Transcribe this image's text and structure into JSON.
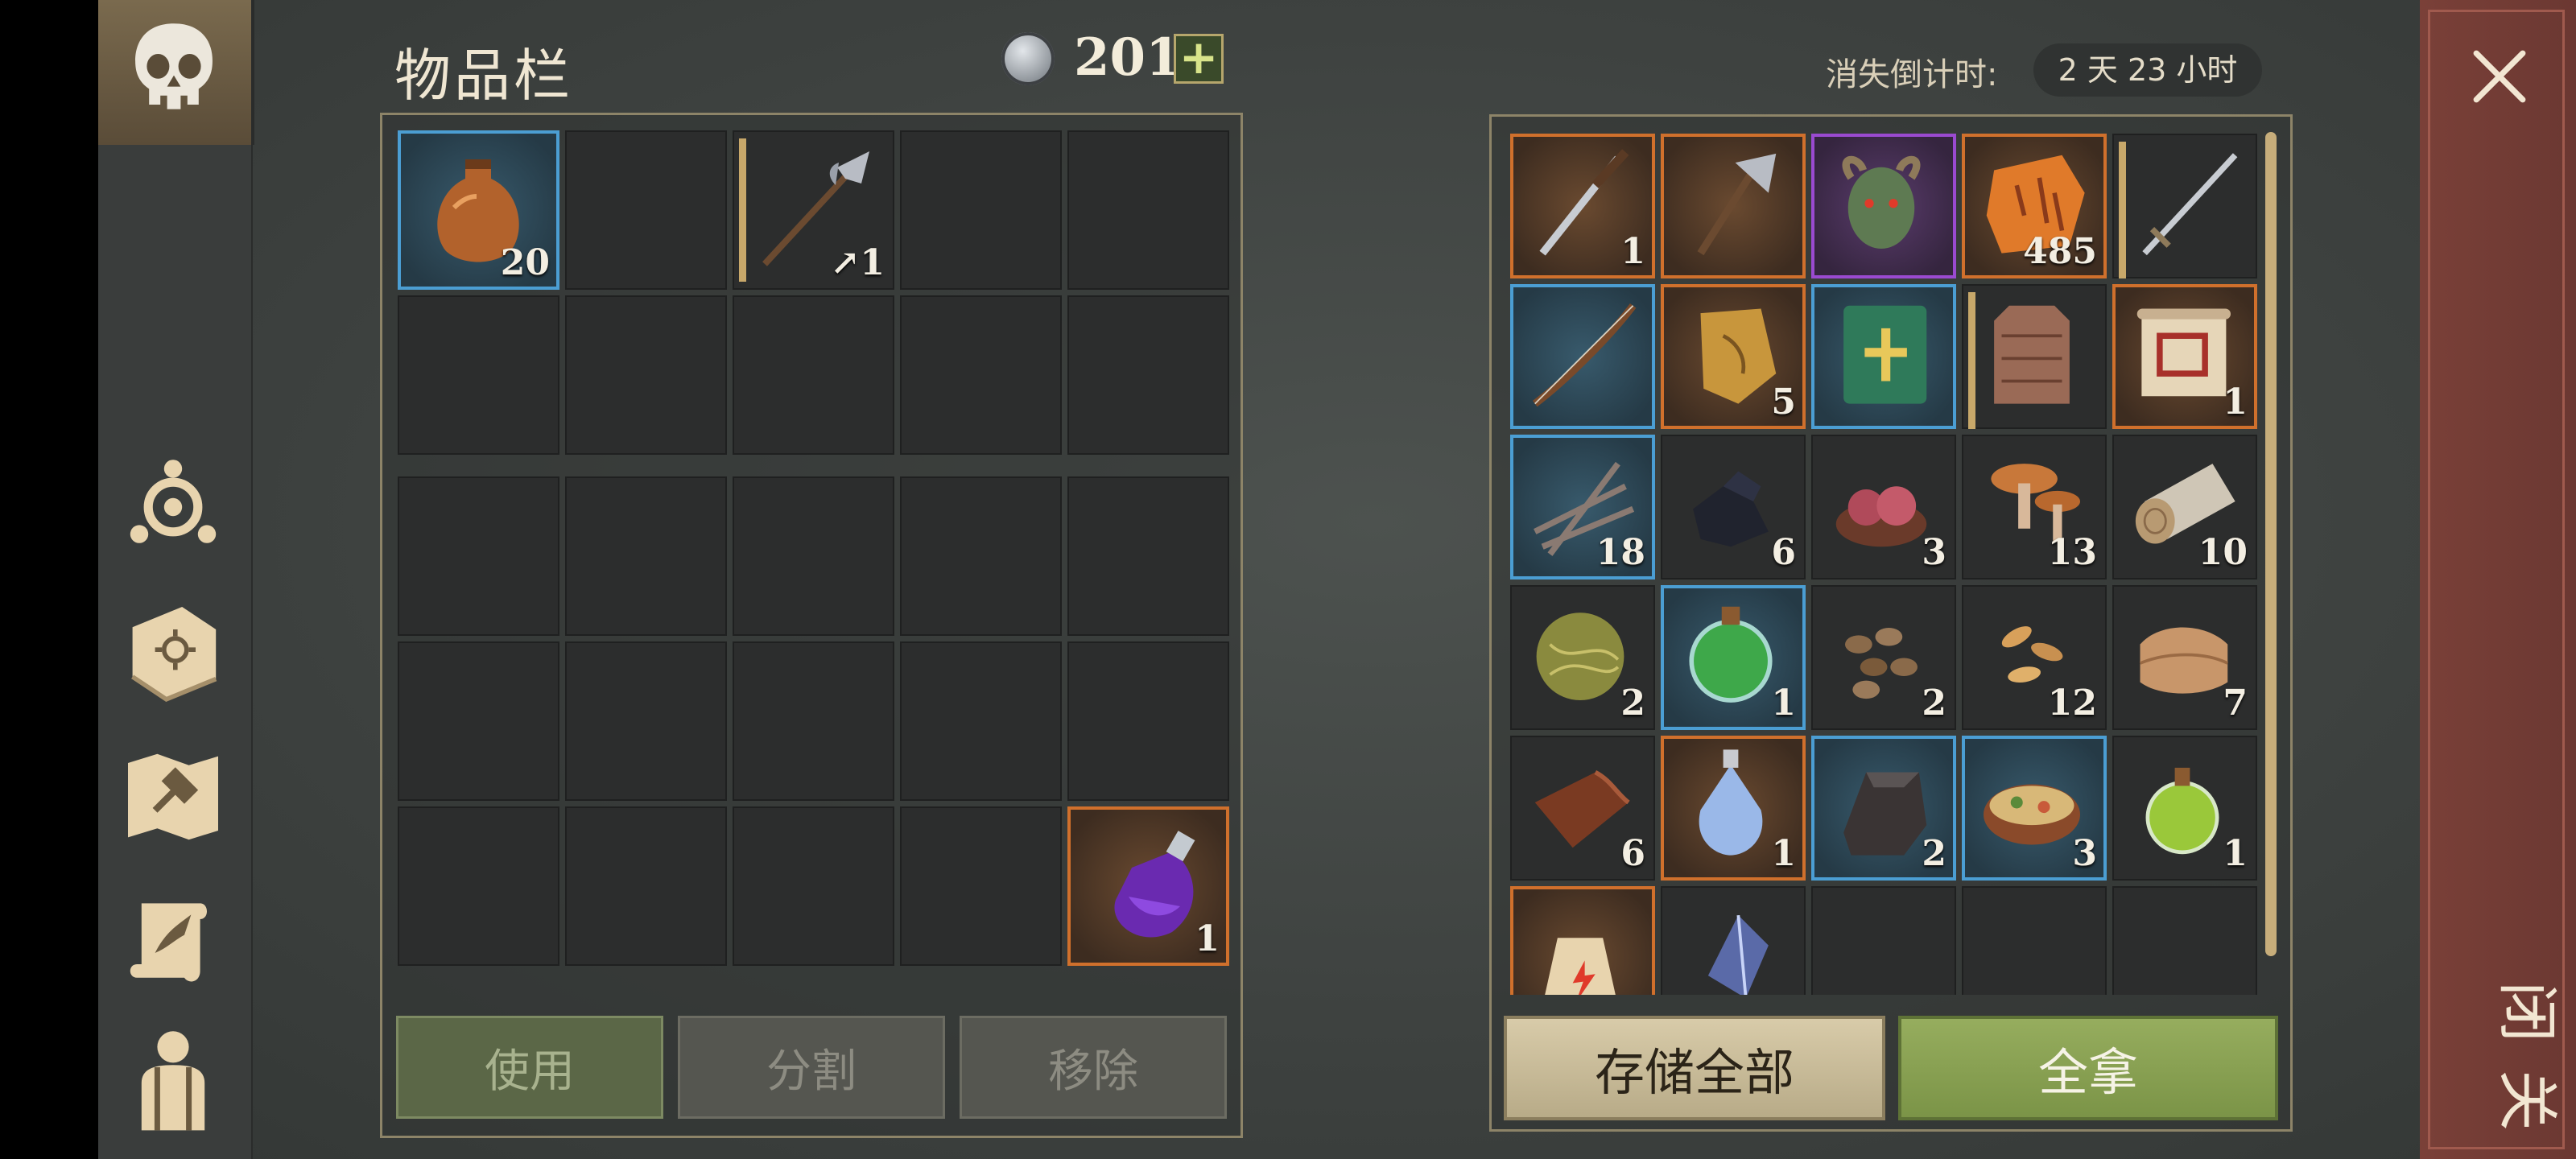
{
  "inventory": {
    "title": "物品栏",
    "currency": "201",
    "add_label": "+",
    "actions": {
      "use": "使用",
      "split": "分割",
      "remove": "移除"
    },
    "slots": [
      {
        "rarity": "blue",
        "icon": "flask-icon",
        "count": "20"
      },
      {
        "rarity": "plain",
        "icon": "",
        "count": ""
      },
      {
        "rarity": "plain",
        "icon": "halberd-icon",
        "count": "1",
        "bar": true,
        "tool": true
      },
      {
        "rarity": "plain",
        "icon": "",
        "count": ""
      },
      {
        "rarity": "plain",
        "icon": "",
        "count": ""
      },
      {
        "rarity": "plain",
        "icon": "",
        "count": ""
      },
      {
        "rarity": "plain",
        "icon": "",
        "count": ""
      },
      {
        "rarity": "plain",
        "icon": "",
        "count": ""
      },
      {
        "rarity": "plain",
        "icon": "",
        "count": ""
      },
      {
        "rarity": "plain",
        "icon": "",
        "count": ""
      }
    ],
    "slots2": [
      {
        "rarity": "plain",
        "icon": "",
        "count": ""
      },
      {
        "rarity": "plain",
        "icon": "",
        "count": ""
      },
      {
        "rarity": "plain",
        "icon": "",
        "count": ""
      },
      {
        "rarity": "plain",
        "icon": "",
        "count": ""
      },
      {
        "rarity": "plain",
        "icon": "",
        "count": ""
      },
      {
        "rarity": "plain",
        "icon": "",
        "count": ""
      },
      {
        "rarity": "plain",
        "icon": "",
        "count": ""
      },
      {
        "rarity": "plain",
        "icon": "",
        "count": ""
      },
      {
        "rarity": "plain",
        "icon": "",
        "count": ""
      },
      {
        "rarity": "plain",
        "icon": "",
        "count": ""
      },
      {
        "rarity": "plain",
        "icon": "",
        "count": ""
      },
      {
        "rarity": "plain",
        "icon": "",
        "count": ""
      },
      {
        "rarity": "plain",
        "icon": "",
        "count": ""
      },
      {
        "rarity": "plain",
        "icon": "",
        "count": ""
      },
      {
        "rarity": "orange",
        "icon": "purple-potion-icon",
        "count": "1"
      }
    ]
  },
  "storage": {
    "timer_label": "消失倒计时:",
    "timer_value": "2 天 23 小时",
    "store_all": "存储全部",
    "take_all": "全拿",
    "slots": [
      {
        "rarity": "orange",
        "icon": "knife-icon",
        "count": "1"
      },
      {
        "rarity": "orange",
        "icon": "axe-icon",
        "count": ""
      },
      {
        "rarity": "purple",
        "icon": "demon-head-icon",
        "count": ""
      },
      {
        "rarity": "orange",
        "icon": "rune-stone-icon",
        "count": "485"
      },
      {
        "rarity": "plain",
        "icon": "sword-icon",
        "count": "",
        "bar": true
      },
      {
        "rarity": "blue",
        "icon": "bow-icon",
        "count": ""
      },
      {
        "rarity": "orange",
        "icon": "map-fragment-icon",
        "count": "5"
      },
      {
        "rarity": "blue",
        "icon": "book-icon",
        "count": ""
      },
      {
        "rarity": "plain",
        "icon": "chainmail-icon",
        "count": "",
        "bar": true
      },
      {
        "rarity": "orange",
        "icon": "scroll-icon",
        "count": "1"
      },
      {
        "rarity": "blue",
        "icon": "sticks-icon",
        "count": "18"
      },
      {
        "rarity": "plain",
        "icon": "coal-icon",
        "count": "6"
      },
      {
        "rarity": "plain",
        "icon": "meat-bowl-icon",
        "count": "3"
      },
      {
        "rarity": "plain",
        "icon": "mushroom-icon",
        "count": "13"
      },
      {
        "rarity": "plain",
        "icon": "log-icon",
        "count": "10"
      },
      {
        "rarity": "plain",
        "icon": "fiber-ball-icon",
        "count": "2"
      },
      {
        "rarity": "blue",
        "icon": "green-potion-icon",
        "count": "1"
      },
      {
        "rarity": "plain",
        "icon": "beans-icon",
        "count": "2"
      },
      {
        "rarity": "plain",
        "icon": "seeds-icon",
        "count": "12"
      },
      {
        "rarity": "plain",
        "icon": "cloth-icon",
        "count": "7"
      },
      {
        "rarity": "plain",
        "icon": "leather-icon",
        "count": "6"
      },
      {
        "rarity": "orange",
        "icon": "crystal-potion-icon",
        "count": "1"
      },
      {
        "rarity": "blue",
        "icon": "iron-ingot-icon",
        "count": "2"
      },
      {
        "rarity": "blue",
        "icon": "stew-icon",
        "count": "3"
      },
      {
        "rarity": "plain",
        "icon": "lime-potion-icon",
        "count": "1"
      },
      {
        "rarity": "orange",
        "icon": "fire-flask-icon",
        "count": ""
      },
      {
        "rarity": "plain",
        "icon": "crystal-shard-icon",
        "count": ""
      },
      {
        "rarity": "plain",
        "icon": "",
        "count": ""
      },
      {
        "rarity": "plain",
        "icon": "",
        "count": ""
      },
      {
        "rarity": "plain",
        "icon": "",
        "count": ""
      }
    ]
  },
  "close_label": "关闭",
  "sidebar": [
    "skull-icon",
    "character-icon",
    "recipe-book-icon",
    "crafting-map-icon",
    "quest-scroll-icon",
    "backpack-icon"
  ]
}
